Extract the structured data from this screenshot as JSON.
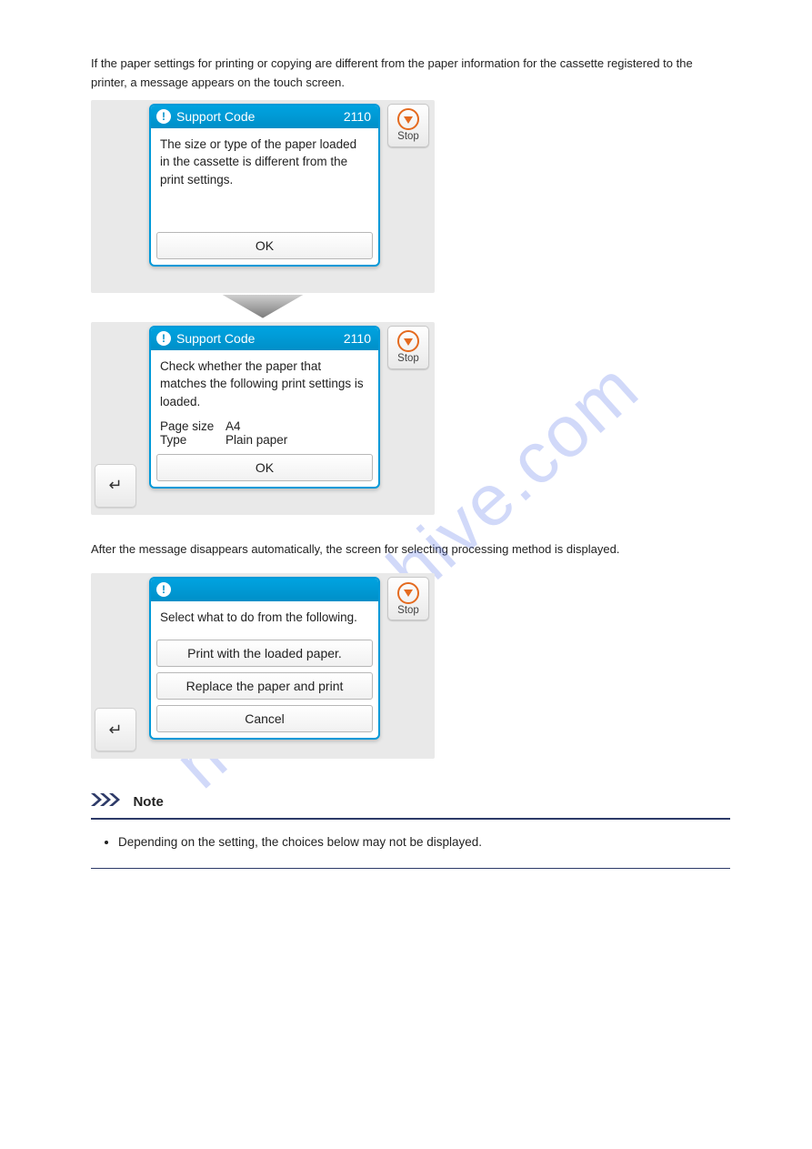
{
  "intro": "If the paper settings for printing or copying are different from the paper information for the cassette registered to the printer, a message appears on the touch screen.",
  "screen1": {
    "title": "Support Code",
    "code": "2110",
    "message": "The size or type of the paper loaded in the cassette is different from the print settings.",
    "ok": "OK",
    "stop": "Stop"
  },
  "screen2": {
    "title": "Support Code",
    "code": "2110",
    "message": "Check whether the paper that matches the following print settings is loaded.",
    "page_size_label": "Page size",
    "page_size_value": "A4",
    "type_label": "Type",
    "type_value": "Plain paper",
    "ok": "OK",
    "stop": "Stop"
  },
  "mid": "After the message disappears automatically, the screen for selecting processing method is displayed.",
  "screen3": {
    "message": "Select what to do from the following.",
    "option1": "Print with the loaded paper.",
    "option2": "Replace the paper and print",
    "option3": "Cancel",
    "stop": "Stop"
  },
  "note": {
    "heading": "Note",
    "item1": "Depending on the setting, the choices below may not be displayed."
  },
  "watermark": "manualshive.com"
}
